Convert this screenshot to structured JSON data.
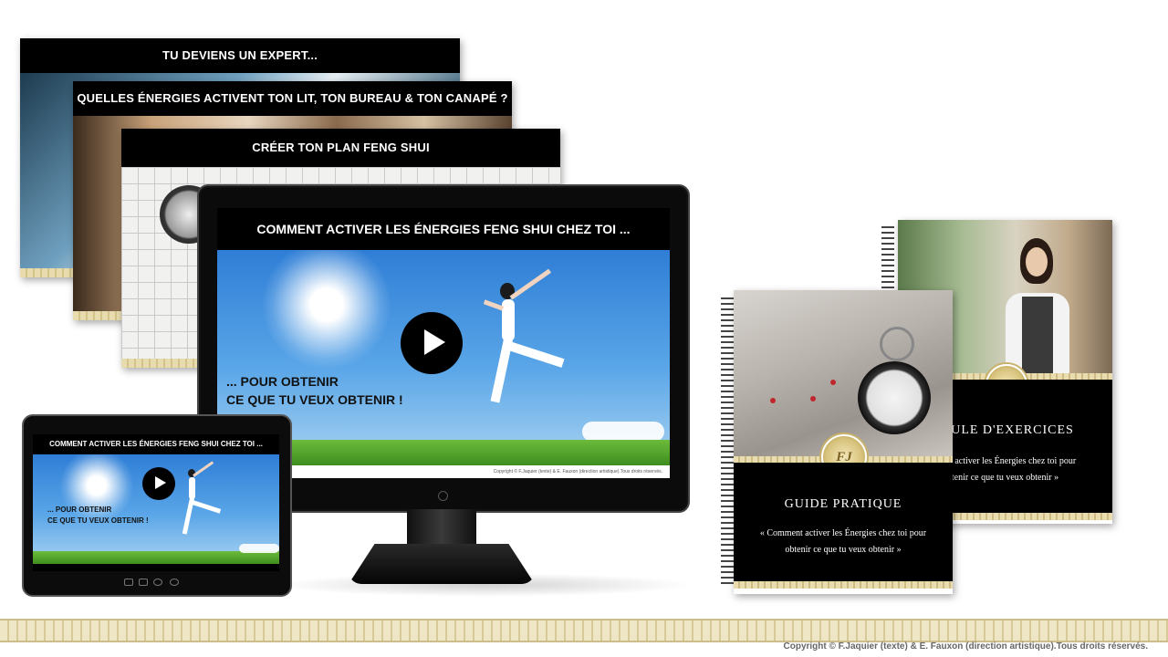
{
  "slides": [
    {
      "title": "TU DEVIENS UN EXPERT..."
    },
    {
      "title": "QUELLES ÉNERGIES ACTIVENT TON LIT, TON BUREAU & TON CANAPÉ ?"
    },
    {
      "title": "CRÉER TON PLAN FENG SHUI"
    }
  ],
  "monitor": {
    "title": "COMMENT ACTIVER LES ÉNERGIES  FENG SHUI CHEZ TOI ...",
    "overlay_line1": "... POUR OBTENIR",
    "overlay_line2": "CE QUE TU VEUX OBTENIR !",
    "copyright": "Copyright © F.Jaquier (texte) & E. Fauxon (direction artistique).Tous droits réservés."
  },
  "tablet": {
    "title": "COMMENT ACTIVER LES ÉNERGIES  FENG SHUI CHEZ TOI ...",
    "overlay_line1": "... POUR OBTENIR",
    "overlay_line2": "CE QUE TU VEUX OBTENIR !"
  },
  "guide": {
    "heading": "GUIDE PRATIQUE",
    "line1": "« Comment activer les Énergies chez toi pour",
    "line2": "obtenir ce que tu veux obtenir »",
    "medal": "FJ"
  },
  "exercises": {
    "heading": "ICULE D'EXERCICES",
    "line1": "ment activer les Énergies chez toi pour",
    "line2": "tenir ce que tu veux obtenir »",
    "medal": "FJ"
  },
  "footer": {
    "copyright": "Copyright © F.Jaquier (texte) & E. Fauxon (direction artistique).Tous droits réservés."
  },
  "colors": {
    "black_bar": "#000000",
    "sky": "#4a97e0",
    "grass": "#5aa72f",
    "gold_trim": "#d8c999"
  }
}
